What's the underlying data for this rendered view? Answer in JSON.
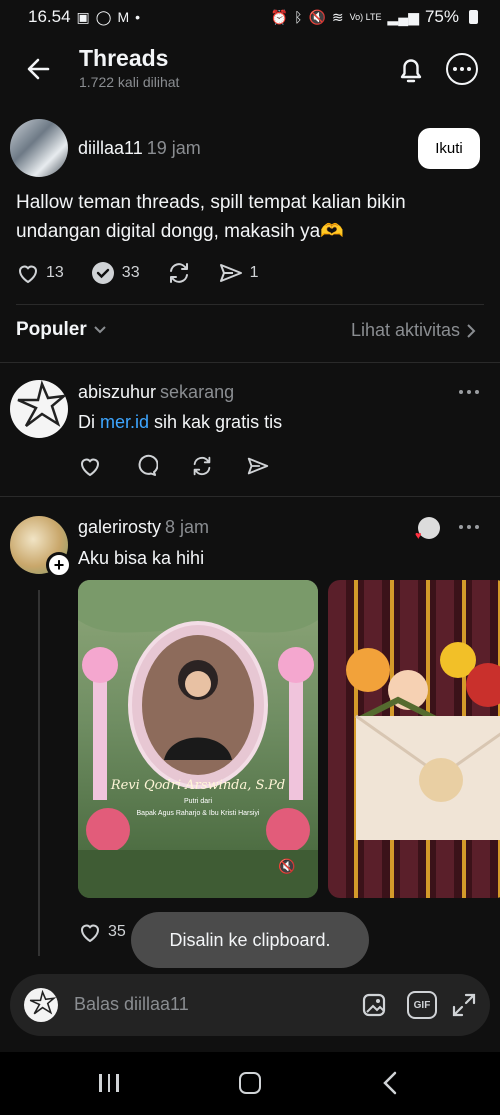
{
  "status_bar": {
    "time": "16.54",
    "battery": "75%",
    "network": "Vo) LTE"
  },
  "header": {
    "title": "Threads",
    "views": "1.722 kali dilihat"
  },
  "post": {
    "username": "diillaa11",
    "time": "19 jam",
    "follow_label": "Ikuti",
    "text_line1": "Hallow teman threads, spill tempat kalian bikin",
    "text_line2": "undangan digital dongg, makasih ya🫶",
    "likes": "13",
    "replies": "33",
    "shares": "1"
  },
  "sort": {
    "label": "Populer",
    "activity_label": "Lihat aktivitas"
  },
  "replies": [
    {
      "username": "abiszuhur",
      "time": "sekarang",
      "text_prefix": "Di ",
      "link": "mer.id",
      "text_suffix": " sih kak gratis tis"
    },
    {
      "username": "galerirosty",
      "time": "8 jam",
      "text": "Aku bisa ka hihi",
      "likes": "35",
      "invitation_name": "Revi Qodri Arswinda, S.Pd",
      "invitation_subtitle": "Putri dari",
      "invitation_parents": "Bapak Agus Raharjo & Ibu Kristi Harsiyi"
    }
  ],
  "toast": "Disalin ke clipboard.",
  "reply_bar": {
    "placeholder": "Balas diillaa11",
    "gif_label": "GIF"
  },
  "colors": {
    "background": "#101010",
    "link": "#3ea6ff",
    "secondary_text": "#8a8d91"
  }
}
